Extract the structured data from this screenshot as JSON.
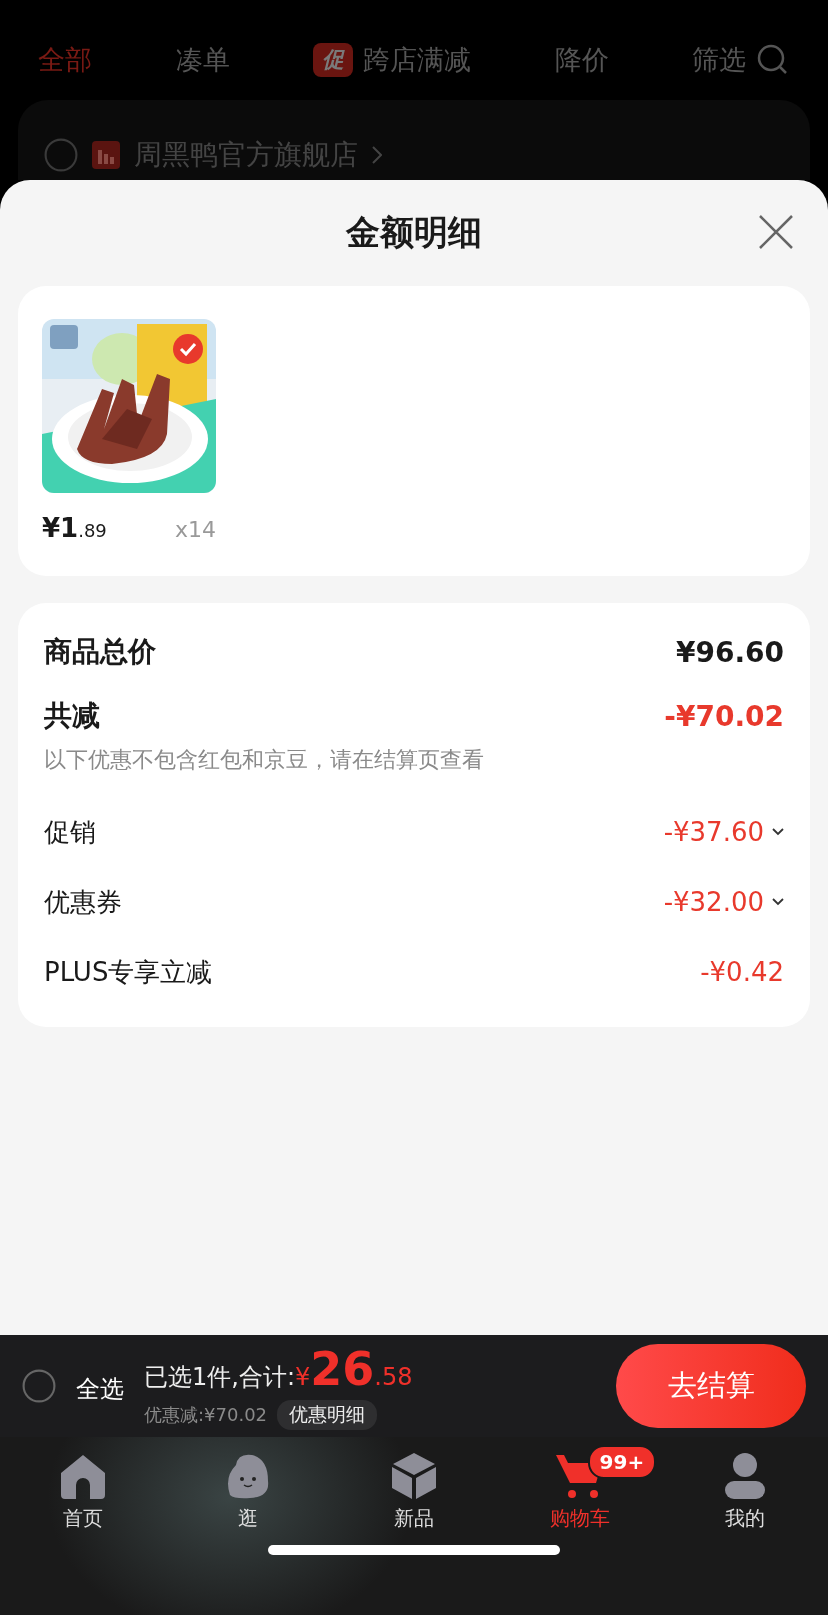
{
  "filter_tabs": [
    {
      "label": "全部",
      "selected": true
    },
    {
      "label": "凑单",
      "selected": false
    },
    {
      "label": "跨店满减",
      "badge": "促",
      "selected": false
    },
    {
      "label": "降价",
      "selected": false
    },
    {
      "label": "筛选",
      "kind": "search",
      "selected": false
    }
  ],
  "store": {
    "name": "周黑鸭官方旗舰店",
    "checked": false
  },
  "sheet": {
    "title": "金额明细"
  },
  "items": [
    {
      "price_main": "¥1",
      "price_cents": ".89",
      "quantity": "x14",
      "checked": true
    }
  ],
  "summary": {
    "total_label": "商品总价",
    "total": "¥96.60",
    "discount_label": "共减",
    "discount": "-¥70.02",
    "note": "以下优惠不包含红包和京豆，请在结算页查看",
    "lines": [
      {
        "label": "促销",
        "amount": "-¥37.60",
        "expandable": true
      },
      {
        "label": "优惠券",
        "amount": "-¥32.00",
        "expandable": true
      },
      {
        "label": "PLUS专享立减",
        "amount": "-¥0.42",
        "expandable": false
      }
    ]
  },
  "checkout": {
    "select_all": "全选",
    "checked": false,
    "selected_text": "已选1件,合计:",
    "currency": "¥",
    "total_main": "26",
    "total_cents": ".58",
    "saved": "优惠减:¥70.02",
    "detail_button": "优惠明细",
    "checkout_button": "去结算"
  },
  "nav": [
    {
      "label": "首页",
      "kind": "home",
      "selected": false
    },
    {
      "label": "逛",
      "kind": "blob",
      "selected": false
    },
    {
      "label": "新品",
      "kind": "cube",
      "selected": false
    },
    {
      "label": "购物车",
      "kind": "cart",
      "badge": "99+",
      "selected": true
    },
    {
      "label": "我的",
      "kind": "person",
      "selected": false
    }
  ]
}
